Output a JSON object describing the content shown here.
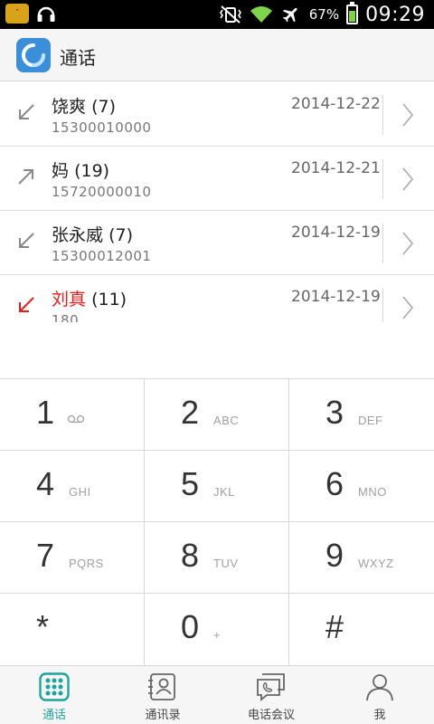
{
  "status_bar": {
    "battery_percent": "67%",
    "time": "09:29"
  },
  "header": {
    "title": "通话"
  },
  "call_log": [
    {
      "name": "饶爽",
      "count": "(7)",
      "number": "15300010000",
      "date": "2014-12-22",
      "direction": "incoming",
      "missed": false
    },
    {
      "name": "妈",
      "count": "(19)",
      "number": "15720000010",
      "date": "2014-12-21",
      "direction": "outgoing",
      "missed": false
    },
    {
      "name": "张永威",
      "count": "(7)",
      "number": "15300012001",
      "date": "2014-12-19",
      "direction": "incoming",
      "missed": false
    },
    {
      "name": "刘真",
      "count": "(11)",
      "number": "180",
      "date": "2014-12-19",
      "direction": "missed",
      "missed": true
    }
  ],
  "keypad": [
    {
      "digit": "1",
      "letters": "",
      "extra": "voicemail"
    },
    {
      "digit": "2",
      "letters": "ABC"
    },
    {
      "digit": "3",
      "letters": "DEF"
    },
    {
      "digit": "4",
      "letters": "GHI"
    },
    {
      "digit": "5",
      "letters": "JKL"
    },
    {
      "digit": "6",
      "letters": "MNO"
    },
    {
      "digit": "7",
      "letters": "PQRS"
    },
    {
      "digit": "8",
      "letters": "TUV"
    },
    {
      "digit": "9",
      "letters": "WXYZ"
    },
    {
      "digit": "*",
      "letters": ""
    },
    {
      "digit": "0",
      "letters": "+"
    },
    {
      "digit": "#",
      "letters": ""
    }
  ],
  "bottom_nav": [
    {
      "label": "通话",
      "icon": "dialpad-icon",
      "active": true
    },
    {
      "label": "通讯录",
      "icon": "contacts-icon",
      "active": false
    },
    {
      "label": "电话会议",
      "icon": "conference-call-icon",
      "active": false
    },
    {
      "label": "我",
      "icon": "profile-icon",
      "active": false
    }
  ],
  "colors": {
    "accent": "#1fa39a",
    "missed": "#e02020"
  }
}
